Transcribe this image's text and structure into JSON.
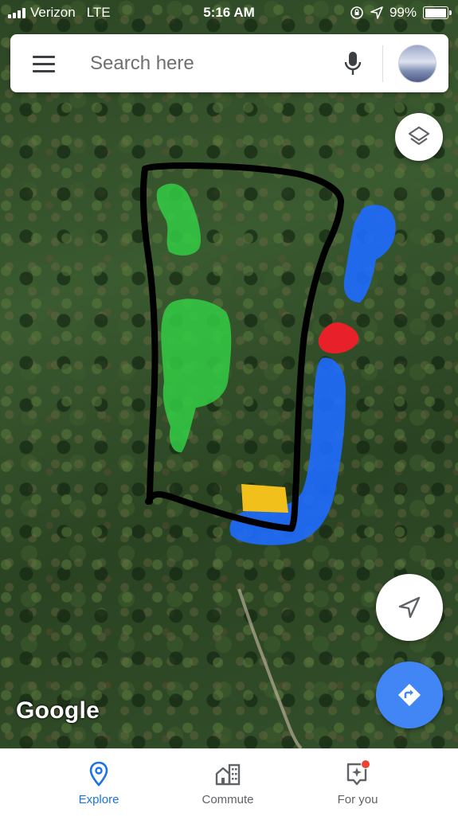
{
  "status_bar": {
    "carrier": "Verizon",
    "network": "LTE",
    "time": "5:16 AM",
    "battery_percent": "99%",
    "battery_level": 0.99,
    "icons": [
      "signal-icon",
      "orientation-lock-icon",
      "location-arrow-icon",
      "battery-icon"
    ]
  },
  "search": {
    "placeholder": "Search here",
    "value": "",
    "icons": [
      "menu-icon",
      "mic-icon",
      "avatar"
    ]
  },
  "map": {
    "attribution": "Google",
    "type": "satellite",
    "drawing_colors": {
      "outline": "#000000",
      "green": "#33cc44",
      "blue": "#1e6bff",
      "red": "#e8202a",
      "yellow": "#f2c01a"
    }
  },
  "map_controls": {
    "icons": [
      "layers-icon",
      "navigate-arrow-icon",
      "directions-icon"
    ],
    "directions_color": "#4285f4"
  },
  "bottom_nav": {
    "items": [
      {
        "label": "Explore",
        "icon": "location-pin-icon",
        "active": true
      },
      {
        "label": "Commute",
        "icon": "commute-buildings-icon",
        "active": false
      },
      {
        "label": "For you",
        "icon": "for-you-sparkle-icon",
        "active": false,
        "badge": true
      }
    ],
    "active_color": "#1a73e8",
    "badge_color": "#ea4335"
  }
}
